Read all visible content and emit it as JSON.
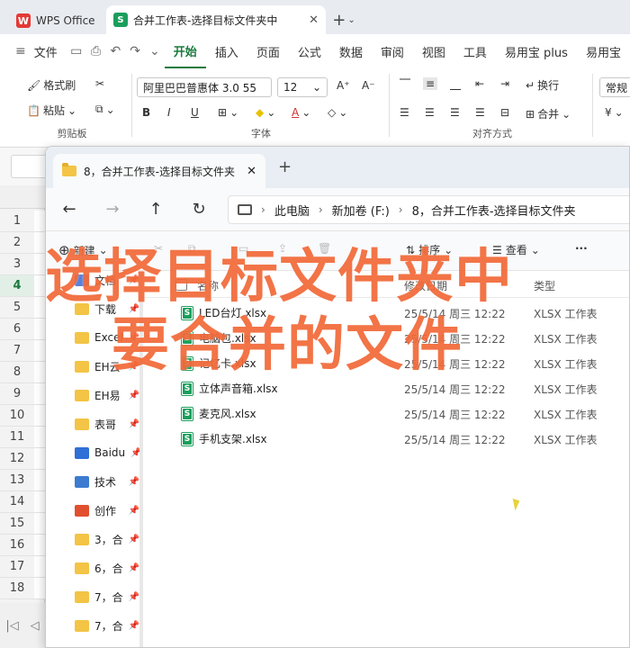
{
  "wps": {
    "home_tab": "WPS Office",
    "doc_tab_title": "合并工作表-选择目标文件夹中",
    "doc_tab_close": "✕",
    "new_tab": "+",
    "menu": [
      "文件",
      "开始",
      "插入",
      "页面",
      "公式",
      "数据",
      "审阅",
      "视图",
      "工具",
      "易用宝 plus",
      "易用宝"
    ],
    "active_menu": "开始"
  },
  "ribbon": {
    "format_painter": "格式刷",
    "paste": "粘贴",
    "clipboard_label": "剪贴板",
    "font_name": "阿里巴巴普惠体 3.0 55",
    "font_size": "12",
    "font_label": "字体",
    "wrap": "换行",
    "merge": "合并",
    "align_label": "对齐方式",
    "number_format": "常规",
    "currency": "¥"
  },
  "rows": [
    "1",
    "2",
    "3",
    "4",
    "5",
    "6",
    "7",
    "8",
    "9",
    "10",
    "11",
    "12",
    "13",
    "14",
    "15",
    "16",
    "17",
    "18"
  ],
  "selected_row": "4",
  "explorer": {
    "tab_title": "8，合并工作表-选择目标文件夹",
    "breadcrumb": [
      "此电脑",
      "新加卷 (F:)",
      "8，合并工作表-选择目标文件夹"
    ],
    "commands": {
      "new": "新建",
      "sort": "排序",
      "view": "查看",
      "more": "···"
    },
    "columns": {
      "name": "名称",
      "date": "修改日期",
      "type": "类型"
    },
    "sidebar": [
      "文档",
      "下载",
      "Excel",
      "EH云",
      "EH易",
      "表哥",
      "Baidu",
      "技术",
      "创作",
      "3，合",
      "6，合",
      "7，合",
      "7，合"
    ],
    "files": [
      {
        "name": "LED台灯.xlsx",
        "date": "25/5/14 周三 12:22",
        "type": "XLSX 工作表"
      },
      {
        "name": "电脑包.xlsx",
        "date": "25/5/14 周三 12:22",
        "type": "XLSX 工作表"
      },
      {
        "name": "记忆卡.xlsx",
        "date": "25/5/14 周三 12:22",
        "type": "XLSX 工作表"
      },
      {
        "name": "立体声音箱.xlsx",
        "date": "25/5/14 周三 12:22",
        "type": "XLSX 工作表"
      },
      {
        "name": "麦克风.xlsx",
        "date": "25/5/14 周三 12:22",
        "type": "XLSX 工作表"
      },
      {
        "name": "手机支架.xlsx",
        "date": "25/5/14 周三 12:22",
        "type": "XLSX 工作表"
      }
    ]
  },
  "overlay": {
    "line1": "选择目标文件夹中",
    "line2": "要合并的文件",
    "color": "#f26a3a"
  }
}
